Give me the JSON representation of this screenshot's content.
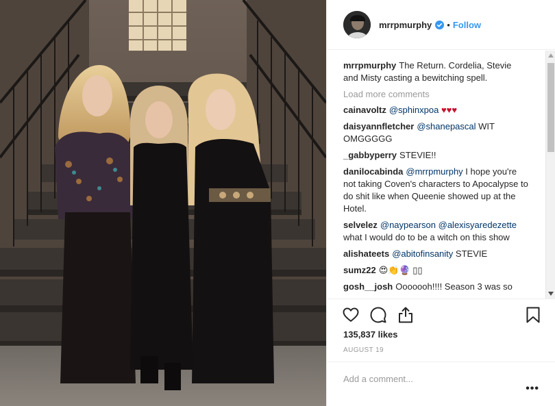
{
  "post": {
    "username": "mrrpmurphy",
    "verified": true,
    "follow_label": "Follow",
    "separator": "•"
  },
  "caption": {
    "username": "mrrpmurphy",
    "text": "The Return. Cordelia, Stevie and Misty casting a bewitching spell."
  },
  "load_more_label": "Load more comments",
  "comments": [
    {
      "user": "cainavoltz",
      "mention": "@sphinxpoa",
      "text": "",
      "extra": "♥♥♥"
    },
    {
      "user": "daisyannfletcher",
      "mention": "@shanepascal",
      "text": "WIT OMGGGGG",
      "extra": ""
    },
    {
      "user": "_gabbyperry",
      "mention": "",
      "text": "STEVIE!!",
      "extra": ""
    },
    {
      "user": "danilocabinda",
      "mention": "@mrrpmurphy",
      "text": "I hope you're not taking Coven's characters to Apocalypse to do shit like when Queenie showed up at the Hotel.",
      "extra": ""
    },
    {
      "user": "selvelez",
      "mention": "@naypearson @alexisyaredezette",
      "text": "what I would do to be a witch on this show",
      "extra": ""
    },
    {
      "user": "alishateets",
      "mention": "@abitofinsanity",
      "text": "STEVIE",
      "extra": ""
    },
    {
      "user": "sumz22",
      "mention": "",
      "text": "😍👏🔮 ▯▯",
      "extra": ""
    },
    {
      "user": "gosh__josh",
      "mention": "",
      "text": "Ooooooh!!!! Season 3 was so",
      "extra": ""
    }
  ],
  "likes_text": "135,837 likes",
  "date_text": "AUGUST 19",
  "add_comment": {
    "placeholder": "Add a comment..."
  },
  "more_label": "•••",
  "icons": {
    "like": "heart-icon",
    "comment": "comment-icon",
    "share": "share-icon",
    "save": "bookmark-icon",
    "verified": "verified-badge-icon"
  },
  "colors": {
    "link": "#3897f0",
    "mention": "#003569",
    "muted": "#999999",
    "text": "#262626",
    "border": "#efefef"
  }
}
